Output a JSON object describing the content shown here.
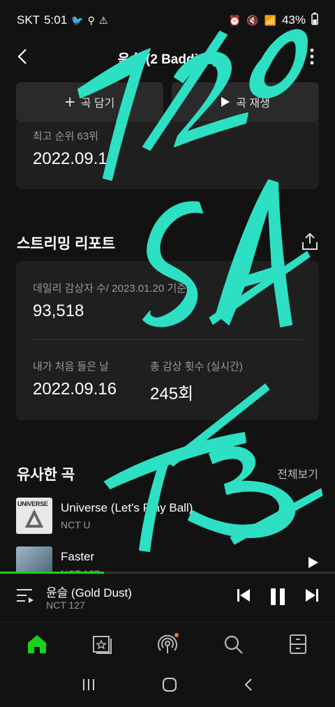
{
  "status_bar": {
    "carrier": "SKT",
    "time": "5:01",
    "battery": "43%",
    "icons": [
      "twitter-icon",
      "twitter-icon",
      "notification-icon",
      "warning-icon",
      "profile-icon",
      "alarm-icon",
      "mute-icon",
      "wifi-icon",
      "signal-icon",
      "battery-icon"
    ]
  },
  "header": {
    "title": "윤슬 (2 Baddies)"
  },
  "actions": {
    "add_label": "곡 담기",
    "play_label": "곡 재생"
  },
  "rank_card": {
    "label": "최고 순위 63위",
    "date": "2022.09.16"
  },
  "streaming_report": {
    "title": "스트리밍 리포트",
    "daily_label": "데일리 감상자 수/ 2023.01.20 기준",
    "daily_value": "93,518",
    "first_listen_label": "내가 처음 들은 날",
    "first_listen_value": "2022.09.16",
    "total_label": "총 감상 횟수 (실시간)",
    "total_value": "245회"
  },
  "similar": {
    "title": "유사한 곡",
    "see_all": "전체보기",
    "items": [
      {
        "title": "Universe (Let's Play Ball)",
        "artist": "NCT U",
        "cover": "UNIVERSE"
      },
      {
        "title": "Faster",
        "artist": "NCT 127",
        "cover": ""
      }
    ]
  },
  "now_playing": {
    "title": "윤슬 (Gold Dust)",
    "artist": "NCT 127",
    "progress": 0.31
  },
  "overlay_text": {
    "line1": "1/20",
    "line2": "SA",
    "line3": "TB"
  },
  "colors": {
    "accent": "#1ad11a",
    "overlay": "#2de0c4",
    "notification_dot": "#ff6b3d"
  }
}
